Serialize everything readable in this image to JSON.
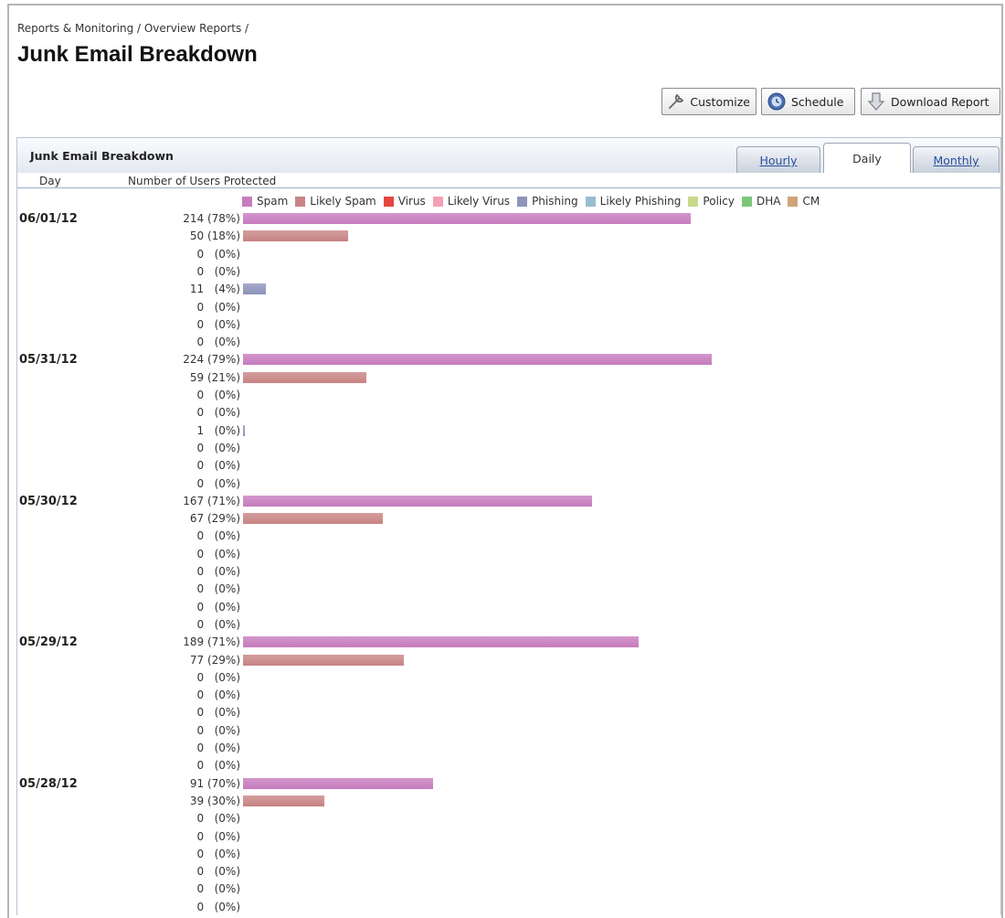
{
  "breadcrumb": "Reports & Monitoring / Overview Reports /",
  "page_title": "Junk Email Breakdown",
  "actions": {
    "customize": "Customize",
    "schedule": "Schedule",
    "download": "Download Report"
  },
  "panel": {
    "title": "Junk Email Breakdown",
    "tabs": [
      {
        "label": "Hourly",
        "active": false
      },
      {
        "label": "Daily",
        "active": true
      },
      {
        "label": "Monthly",
        "active": false
      }
    ],
    "columns": [
      "Day",
      "Number of Users Protected"
    ]
  },
  "colors": {
    "Spam": "#c77dbf",
    "Likely Spam": "#c98585",
    "Virus": "#e4473f",
    "Likely Virus": "#f4a0b4",
    "Phishing": "#8f94bc",
    "Likely Phishing": "#98bcd0",
    "Policy": "#c8d88c",
    "DHA": "#7cc67a",
    "CM": "#cfa47a"
  },
  "chart_data": {
    "type": "bar",
    "orientation": "horizontal",
    "series_names": [
      "Spam",
      "Likely Spam",
      "Virus",
      "Likely Virus",
      "Phishing",
      "Likely Phishing",
      "Policy",
      "DHA",
      "CM"
    ],
    "groups": [
      {
        "day": "06/01/12",
        "rows": [
          {
            "value": 214,
            "pct": "78%",
            "series": "Spam"
          },
          {
            "value": 50,
            "pct": "18%",
            "series": "Likely Spam"
          },
          {
            "value": 0,
            "pct": "0%",
            "series": "Virus"
          },
          {
            "value": 0,
            "pct": "0%",
            "series": "Likely Virus"
          },
          {
            "value": 11,
            "pct": "4%",
            "series": "Phishing"
          },
          {
            "value": 0,
            "pct": "0%",
            "series": "Likely Phishing"
          },
          {
            "value": 0,
            "pct": "0%",
            "series": "Policy"
          },
          {
            "value": 0,
            "pct": "0%",
            "series": "DHA"
          }
        ]
      },
      {
        "day": "05/31/12",
        "rows": [
          {
            "value": 224,
            "pct": "79%",
            "series": "Spam"
          },
          {
            "value": 59,
            "pct": "21%",
            "series": "Likely Spam"
          },
          {
            "value": 0,
            "pct": "0%",
            "series": "Virus"
          },
          {
            "value": 0,
            "pct": "0%",
            "series": "Likely Virus"
          },
          {
            "value": 1,
            "pct": "0%",
            "series": "Phishing"
          },
          {
            "value": 0,
            "pct": "0%",
            "series": "Likely Phishing"
          },
          {
            "value": 0,
            "pct": "0%",
            "series": "Policy"
          },
          {
            "value": 0,
            "pct": "0%",
            "series": "DHA"
          }
        ]
      },
      {
        "day": "05/30/12",
        "rows": [
          {
            "value": 167,
            "pct": "71%",
            "series": "Spam"
          },
          {
            "value": 67,
            "pct": "29%",
            "series": "Likely Spam"
          },
          {
            "value": 0,
            "pct": "0%",
            "series": "Virus"
          },
          {
            "value": 0,
            "pct": "0%",
            "series": "Likely Virus"
          },
          {
            "value": 0,
            "pct": "0%",
            "series": "Phishing"
          },
          {
            "value": 0,
            "pct": "0%",
            "series": "Likely Phishing"
          },
          {
            "value": 0,
            "pct": "0%",
            "series": "Policy"
          },
          {
            "value": 0,
            "pct": "0%",
            "series": "DHA"
          }
        ]
      },
      {
        "day": "05/29/12",
        "rows": [
          {
            "value": 189,
            "pct": "71%",
            "series": "Spam"
          },
          {
            "value": 77,
            "pct": "29%",
            "series": "Likely Spam"
          },
          {
            "value": 0,
            "pct": "0%",
            "series": "Virus"
          },
          {
            "value": 0,
            "pct": "0%",
            "series": "Likely Virus"
          },
          {
            "value": 0,
            "pct": "0%",
            "series": "Phishing"
          },
          {
            "value": 0,
            "pct": "0%",
            "series": "Likely Phishing"
          },
          {
            "value": 0,
            "pct": "0%",
            "series": "Policy"
          },
          {
            "value": 0,
            "pct": "0%",
            "series": "DHA"
          }
        ]
      },
      {
        "day": "05/28/12",
        "rows": [
          {
            "value": 91,
            "pct": "70%",
            "series": "Spam"
          },
          {
            "value": 39,
            "pct": "30%",
            "series": "Likely Spam"
          },
          {
            "value": 0,
            "pct": "0%",
            "series": "Virus"
          },
          {
            "value": 0,
            "pct": "0%",
            "series": "Likely Virus"
          },
          {
            "value": 0,
            "pct": "0%",
            "series": "Phishing"
          },
          {
            "value": 0,
            "pct": "0%",
            "series": "Likely Phishing"
          },
          {
            "value": 0,
            "pct": "0%",
            "series": "Policy"
          },
          {
            "value": 0,
            "pct": "0%",
            "series": "DHA"
          }
        ]
      }
    ]
  }
}
